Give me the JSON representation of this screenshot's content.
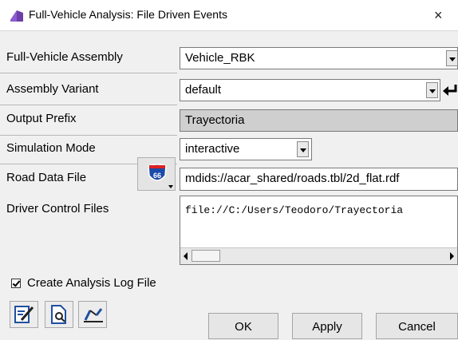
{
  "window": {
    "title": "Full-Vehicle Analysis: File Driven Events",
    "close_glyph": "×"
  },
  "form": {
    "assembly_label": "Full-Vehicle Assembly",
    "assembly_value": "Vehicle_RBK",
    "variant_label": "Assembly Variant",
    "variant_value": "default",
    "prefix_label": "Output Prefix",
    "prefix_value": "Trayectoria",
    "sim_mode_label": "Simulation Mode",
    "sim_mode_value": "interactive",
    "road_label": "Road Data File",
    "road_value": "mdids://acar_shared/roads.tbl/2d_flat.rdf",
    "driver_label": "Driver Control Files",
    "driver_value": "file://C:/Users/Teodoro/Trayectoria"
  },
  "options": {
    "log_label": "Create Analysis Log File",
    "log_checked": true
  },
  "icons": {
    "app": "car-icon",
    "road": "route-66-shield-icon",
    "tool1": "edit-notes-icon",
    "tool2": "file-view-icon",
    "tool3": "suspension-plot-icon"
  },
  "buttons": {
    "ok": "OK",
    "apply": "Apply",
    "cancel": "Cancel"
  }
}
